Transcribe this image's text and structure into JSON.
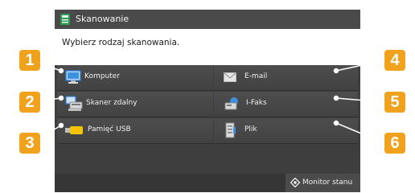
{
  "title": "Skanowanie",
  "prompt": "Wybierz rodzaj skanowania.",
  "buttons": [
    {
      "label": "Komputer",
      "icon": "computer-icon"
    },
    {
      "label": "E-mail",
      "icon": "envelope-icon"
    },
    {
      "label": "Skaner zdalny",
      "icon": "remote-scanner-icon"
    },
    {
      "label": "I-Faks",
      "icon": "i-fax-icon"
    },
    {
      "label": "Pamięć USB",
      "icon": "usb-memory-icon"
    },
    {
      "label": "Plik",
      "icon": "file-icon"
    }
  ],
  "footer": {
    "monitor_label": "Monitor stanu"
  },
  "callouts": [
    "1",
    "2",
    "3",
    "4",
    "5",
    "6"
  ],
  "colors": {
    "badge": "#f0a21c",
    "screen": "#3e3e3e",
    "button": "#4a4a4a"
  }
}
